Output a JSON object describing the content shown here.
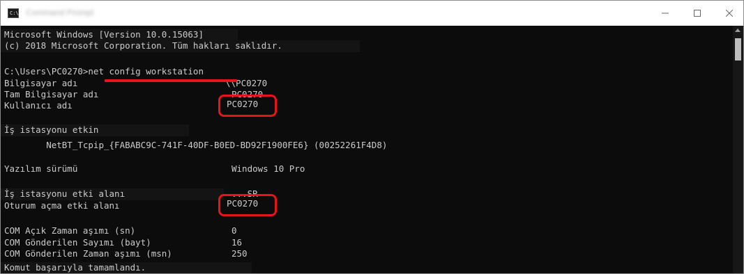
{
  "window": {
    "title": "Command Prompt",
    "icon_label": "C:\\",
    "controls": [
      "minimize",
      "maximize",
      "close"
    ]
  },
  "console": {
    "lines": [
      "Microsoft Windows [Version 10.0.15063]",
      "(c) 2018 Microsoft Corporation. Tüm hakları saklıdır.",
      "C:\\Users\\PC0270>net config workstation",
      "Bilgisayar adı",
      "Tam Bilgisayar adı",
      "Kullanıcı adı",
      "İş istasyonu etkin",
      "        NetBT_Tcpip_{FABABC9C-741F-40DF-B0ED-BD92F1900FE6} (00252261F4D8)",
      "Yazılım sürümü",
      "İş istasyonu etki alanı",
      "Oturum açma etki alanı",
      "COM Açık Zaman aşımı (sn)",
      "COM Gönderilen Sayımı (bayt)",
      "COM Gönderilen Zaman aşımı (msn)",
      "Komut başarıyla tamamlandı."
    ],
    "values": {
      "computer_name": "\\\\PC0270",
      "full_computer_name": "PC0270",
      "user_name": "PC0270",
      "software_version": "Windows 10 Pro",
      "workstation_domain": "...SR",
      "logon_domain": "PC0270",
      "com_open_timeout": "0",
      "com_send_count": "16",
      "com_send_timeout": "250"
    }
  },
  "annotation_colors": {
    "highlight": "#e8141b"
  }
}
